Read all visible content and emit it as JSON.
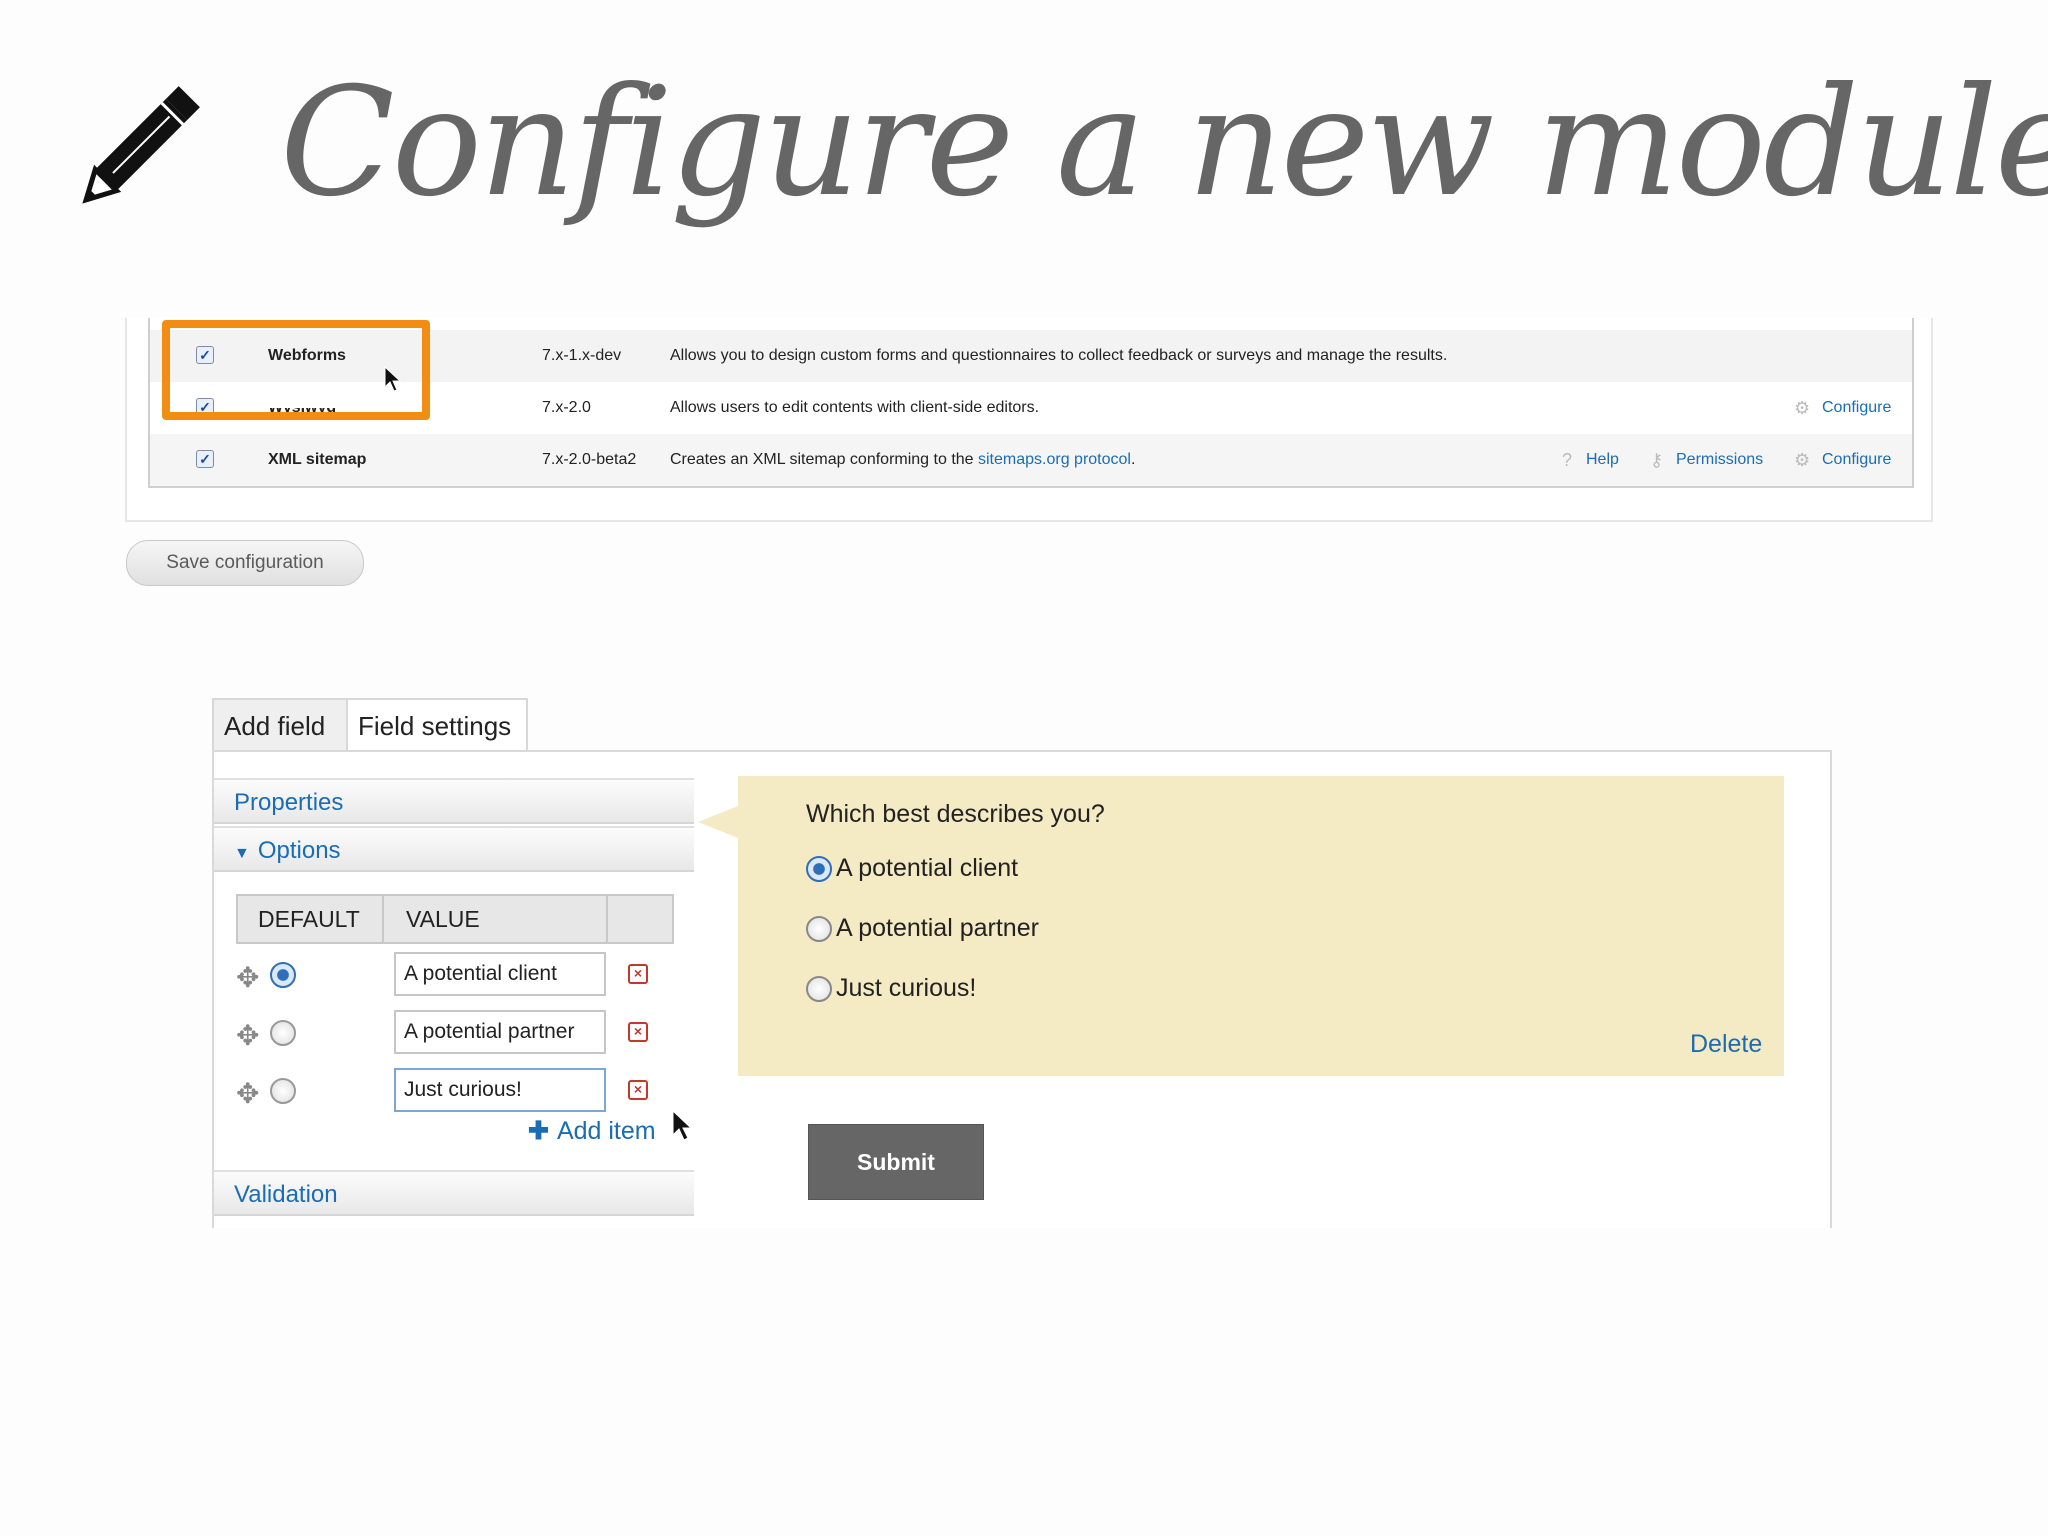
{
  "slide": {
    "title": "Configure a new module"
  },
  "modules": {
    "rows": [
      {
        "name": "Webforms",
        "version": "7.x-1.x-dev",
        "description": "Allows you to design custom forms and questionnaires to collect feedback or surveys and manage the results.",
        "links": []
      },
      {
        "name": "Wysiwyg",
        "version": "7.x-2.0",
        "description": "Allows users to edit contents with client-side editors.",
        "links": [
          "Configure"
        ]
      },
      {
        "name": "XML sitemap",
        "version": "7.x-2.0-beta2",
        "description_prefix": "Creates an XML sitemap conforming to the ",
        "description_link": "sitemaps.org protocol",
        "description_suffix": ".",
        "links": [
          "Help",
          "Permissions",
          "Configure"
        ]
      }
    ],
    "save_button": "Save configuration"
  },
  "form_builder": {
    "tabs": [
      "Add field",
      "Field settings"
    ],
    "sections": {
      "properties": "Properties",
      "options": "Options",
      "validation": "Validation"
    },
    "options_table": {
      "headers": [
        "DEFAULT",
        "VALUE"
      ],
      "rows": [
        {
          "value": "A potential client",
          "default": true
        },
        {
          "value": "A potential partner",
          "default": false
        },
        {
          "value": "Just curious!",
          "default": false
        }
      ],
      "add_item": "Add item"
    },
    "preview": {
      "question": "Which best describes you?",
      "options": [
        "A potential client",
        "A potential partner",
        "Just curious!"
      ],
      "selected_index": 0,
      "delete": "Delete",
      "submit": "Submit"
    }
  },
  "colors": {
    "highlight": "#f28c12",
    "link": "#1a6db4",
    "preview_bg": "#f4eac4",
    "submit_bg": "#666666"
  }
}
